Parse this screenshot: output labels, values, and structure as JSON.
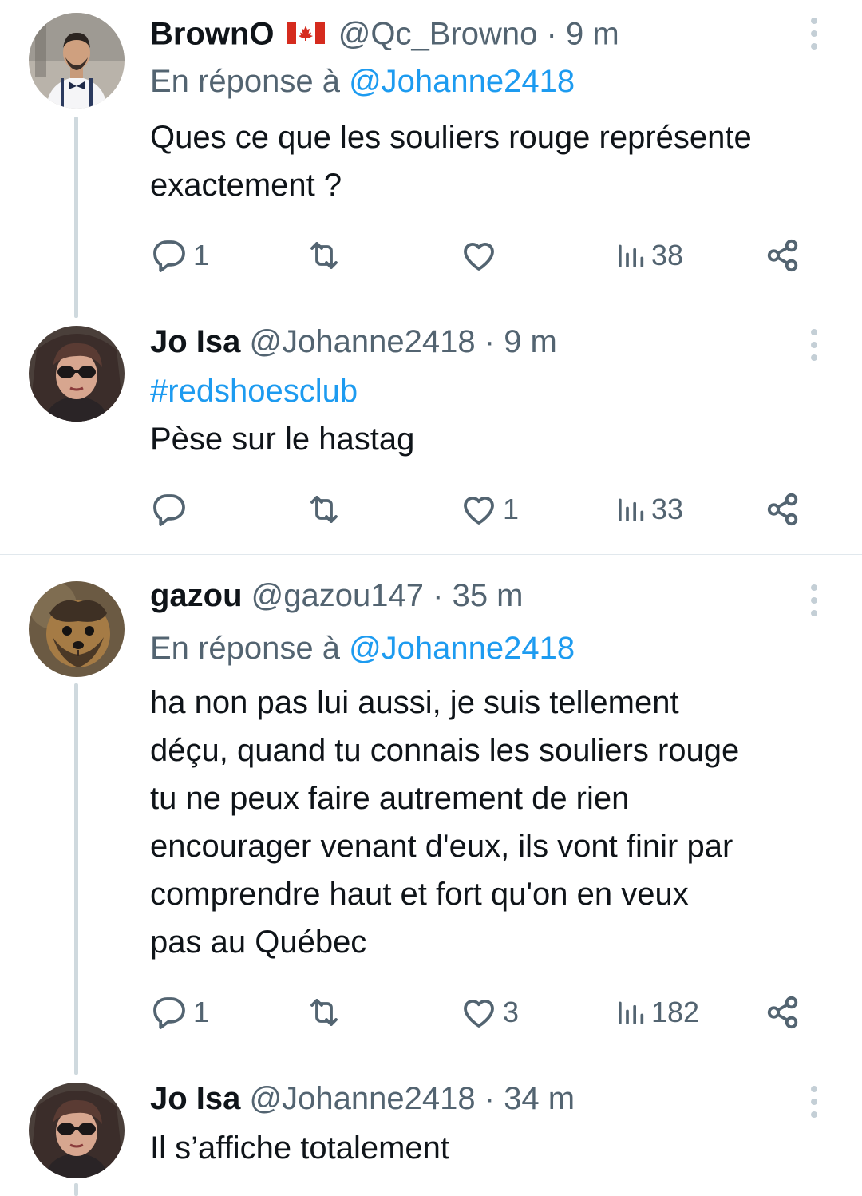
{
  "tweets": [
    {
      "name": "BrownO",
      "flag": "canada-flag-icon",
      "handle": "@Qc_Browno",
      "dot": "·",
      "time": "9 m",
      "reply_prefix": "En réponse à",
      "reply_handle": "@Johanne2418",
      "lines": [
        "Ques ce que les souliers rouge représente",
        "exactement ?"
      ],
      "replies": "1",
      "retweets": "",
      "likes": "",
      "views": "38"
    },
    {
      "name": "Jo Isa",
      "handle": "@Johanne2418",
      "dot": "·",
      "time": "9 m",
      "hashtag": "#redshoesclub",
      "lines": [
        "Pèse sur le hastag"
      ],
      "replies": "",
      "retweets": "",
      "likes": "1",
      "views": "33"
    },
    {
      "name": "gazou",
      "handle": "@gazou147",
      "dot": "·",
      "time": "35 m",
      "reply_prefix": "En réponse à",
      "reply_handle": "@Johanne2418",
      "lines": [
        "ha non pas lui aussi, je suis tellement",
        "déçu, quand tu connais les souliers rouge",
        "tu ne peux faire autrement de rien",
        "encourager venant d'eux, ils vont finir par",
        "comprendre haut et fort qu'on en veux",
        "pas au Québec"
      ],
      "replies": "1",
      "retweets": "",
      "likes": "3",
      "views": "182"
    },
    {
      "name": "Jo Isa",
      "handle": "@Johanne2418",
      "dot": "·",
      "time": "34 m",
      "lines": [
        "Il s’affiche totalement"
      ]
    }
  ],
  "colors": {
    "text": "#0f1419",
    "muted": "#536471",
    "link": "#1d9bf0",
    "thread": "#cfd9de"
  }
}
